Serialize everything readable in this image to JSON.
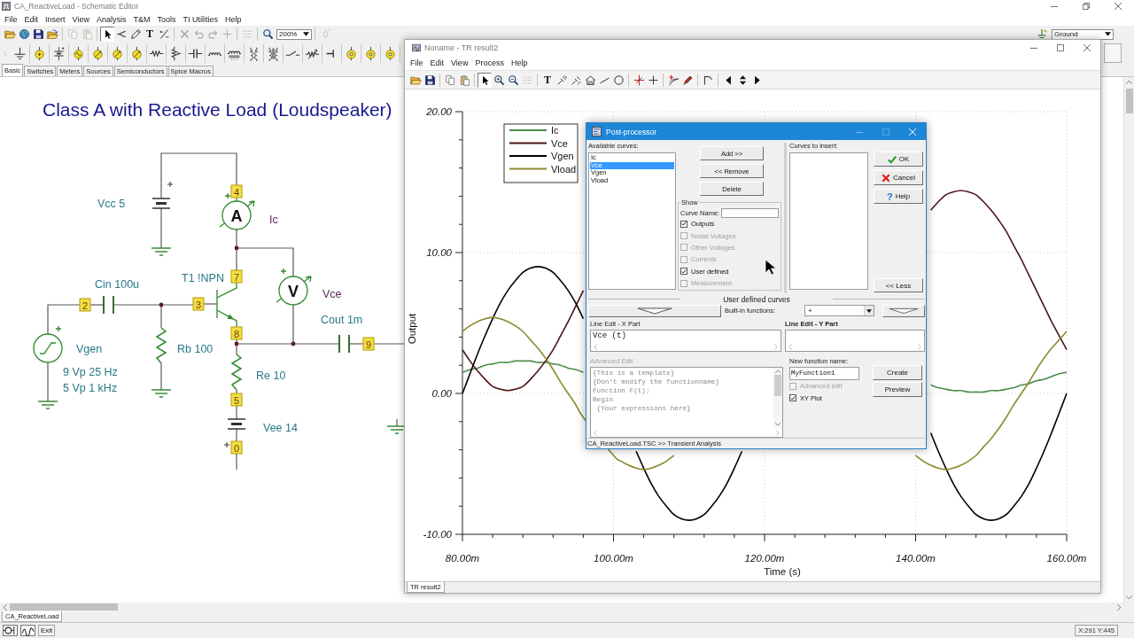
{
  "window": {
    "title": "CA_ReactiveLoad - Schematic Editor"
  },
  "menu": [
    "File",
    "Edit",
    "Insert",
    "View",
    "Analysis",
    "T&M",
    "Tools",
    "TI Utilities",
    "Help"
  ],
  "toolbar": {
    "buttons": [
      {
        "pressed": false,
        "disabled": false
      },
      {
        "pressed": false,
        "disabled": false
      },
      {
        "pressed": false,
        "disabled": false
      },
      {
        "pressed": false,
        "disabled": false
      },
      {
        "pressed": false,
        "disabled": true
      },
      {
        "pressed": false,
        "disabled": true
      },
      {
        "pressed": true,
        "disabled": false
      },
      {
        "pressed": false,
        "disabled": false
      },
      {
        "pressed": false,
        "disabled": false
      },
      {
        "glyph": "T",
        "pressed": false,
        "disabled": false
      },
      {
        "pressed": false,
        "disabled": false
      },
      {
        "pressed": false,
        "disabled": true
      },
      {
        "pressed": false,
        "disabled": true
      },
      {
        "pressed": false,
        "disabled": true
      },
      {
        "pressed": false,
        "disabled": true
      },
      {
        "pressed": false,
        "disabled": false
      },
      {
        "pressed": false,
        "disabled": false
      },
      {
        "pressed": false,
        "disabled": true
      }
    ],
    "zoom_level": "200%",
    "component": "Ground"
  },
  "component_tabs": [
    {
      "label": "Basic",
      "selected": true
    },
    {
      "label": "Switches",
      "selected": false
    },
    {
      "label": "Meters",
      "selected": false
    },
    {
      "label": "Sources",
      "selected": false
    },
    {
      "label": "Semiconductors",
      "selected": false
    },
    {
      "label": "Spice Macros",
      "selected": false
    }
  ],
  "schematic": {
    "title": "Class A with Reactive Load (Loudspeaker)",
    "components": [
      {
        "kind": "battery",
        "label": "Vcc 5"
      },
      {
        "kind": "ammeter",
        "symbol": "A",
        "label": "Ic"
      },
      {
        "kind": "voltmeter",
        "symbol": "V",
        "label": "Vce"
      },
      {
        "kind": "transistor",
        "label": "T1 !NPN"
      },
      {
        "kind": "capacitor",
        "label": "Cin 100u"
      },
      {
        "kind": "capacitor",
        "label": "Cout 1m"
      },
      {
        "kind": "generator",
        "label": "Vgen",
        "settings": [
          "9 Vp 25 Hz",
          "5 Vp 1 kHz"
        ]
      },
      {
        "kind": "resistor",
        "label": "Rb 100"
      },
      {
        "kind": "resistor",
        "label": "Re 10"
      },
      {
        "kind": "battery",
        "label": "Vee 14"
      }
    ],
    "nodes": [
      "4",
      "7",
      "2",
      "3",
      "8",
      "9",
      "5",
      "0"
    ]
  },
  "result_window": {
    "title": "Noname - TR result2",
    "menu": [
      "File",
      "Edit",
      "View",
      "Process",
      "Help"
    ],
    "toolbar": [
      {
        "pressed": false
      },
      {
        "pressed": false
      },
      {
        "pressed": false
      },
      {
        "pressed": false
      },
      {
        "pressed": true
      },
      {
        "pressed": false
      },
      {
        "pressed": false
      },
      {
        "pressed": false
      },
      {
        "glyph": "T",
        "pressed": false
      },
      {
        "pressed": false
      },
      {
        "pressed": false
      },
      {
        "pressed": false
      },
      {
        "pressed": false
      },
      {
        "pressed": false
      },
      {
        "pressed": false
      },
      {
        "pressed": false
      },
      {
        "pressed": false
      },
      {
        "pressed": false
      },
      {
        "pressed": false
      },
      {
        "pressed": false
      },
      {
        "pressed": false
      },
      {
        "pressed": false
      }
    ],
    "chart_data": {
      "type": "line",
      "xlabel": "Time (s)",
      "ylabel": "Output",
      "legend": "upper left",
      "grid": true,
      "x": [
        80,
        81,
        82,
        83,
        84,
        85,
        86,
        87,
        88,
        89,
        90,
        91,
        92,
        93,
        94,
        95,
        96,
        100,
        101,
        102,
        103,
        104,
        105,
        106,
        107,
        108,
        109,
        110,
        111,
        112,
        113,
        114,
        115,
        116,
        117,
        140,
        141,
        142,
        143,
        144,
        145,
        146,
        147,
        148,
        149,
        150,
        151,
        152,
        153,
        154,
        155,
        156,
        157,
        158,
        159,
        160
      ],
      "series": [
        {
          "name": "Ic",
          "color": "#4a8c4a",
          "values": [
            1.5,
            1.7,
            1.8,
            2.0,
            2.1,
            2.2,
            2.2,
            2.3,
            2.3,
            2.3,
            2.2,
            2.2,
            2.1,
            2.0,
            1.8,
            1.7,
            1.5,
            null,
            null,
            null,
            null,
            null,
            null,
            null,
            null,
            null,
            null,
            null,
            null,
            null,
            null,
            null,
            null,
            null,
            null,
            null,
            null,
            0.6,
            0.4,
            0.3,
            0.2,
            0.2,
            0.1,
            0.1,
            0.1,
            0.2,
            0.2,
            0.3,
            0.4,
            0.6,
            0.7,
            0.9,
            1.0,
            1.2,
            1.4,
            1.5
          ]
        },
        {
          "name": "Vce",
          "color": "#4e1414",
          "values": [
            3.1,
            2.3,
            1.6,
            1.0,
            0.5,
            0.3,
            0.2,
            0.3,
            0.5,
            1.0,
            1.6,
            2.3,
            3.1,
            4.1,
            5.1,
            6.2,
            7.3,
            null,
            null,
            null,
            null,
            null,
            null,
            null,
            null,
            null,
            null,
            null,
            null,
            null,
            null,
            null,
            null,
            null,
            null,
            null,
            null,
            13.0,
            13.6,
            14.1,
            14.3,
            14.4,
            14.3,
            14.1,
            13.6,
            13.0,
            12.3,
            11.5,
            10.5,
            9.5,
            8.4,
            7.3,
            6.2,
            5.1,
            4.1,
            3.1
          ]
        },
        {
          "name": "Vgen",
          "color": "#000000",
          "values": [
            0,
            1.4,
            2.8,
            4.1,
            5.3,
            6.4,
            7.3,
            8.0,
            8.6,
            8.9,
            9.0,
            8.9,
            8.6,
            8.0,
            7.3,
            6.4,
            5.3,
            null,
            null,
            null,
            -4.1,
            -5.3,
            -6.4,
            -7.3,
            -8.0,
            -8.6,
            -8.9,
            -9.0,
            -8.9,
            -8.6,
            -8.0,
            -7.3,
            -6.4,
            -5.3,
            -4.1,
            null,
            null,
            -2.8,
            -4.1,
            -5.3,
            -6.4,
            -7.3,
            -8.0,
            -8.6,
            -8.9,
            -9.0,
            -8.9,
            -8.6,
            -8.0,
            -7.3,
            -6.4,
            -5.3,
            -4.1,
            -2.8,
            -1.4,
            0
          ]
        },
        {
          "name": "Vload",
          "color": "#8a8a2e",
          "values": [
            4.4,
            4.8,
            5.1,
            5.3,
            5.4,
            5.3,
            5.1,
            4.8,
            4.4,
            3.8,
            3.2,
            2.5,
            1.7,
            0.8,
            0,
            -0.8,
            -1.7,
            -4.4,
            -4.8,
            -5.1,
            -5.3,
            -5.4,
            -5.3,
            -5.1,
            -4.8,
            -4.4,
            null,
            null,
            null,
            null,
            null,
            null,
            null,
            null,
            null,
            -4.4,
            -4.8,
            -5.1,
            -5.3,
            -5.4,
            -5.3,
            -5.1,
            -4.8,
            -4.4,
            -3.8,
            -3.2,
            -2.5,
            -1.7,
            -0.8,
            0,
            0.8,
            1.7,
            2.5,
            3.2,
            3.8,
            4.4
          ]
        }
      ],
      "xlim": [
        80,
        160
      ],
      "ylim": [
        -10,
        20
      ],
      "xticks": [
        {
          "value": 80,
          "label": "80.00m"
        },
        {
          "value": 100,
          "label": "100.00m"
        },
        {
          "value": 120,
          "label": "120.00m"
        },
        {
          "value": 140,
          "label": "140.00m"
        },
        {
          "value": 160,
          "label": "160.00m"
        }
      ],
      "yticks": [
        {
          "value": -10,
          "label": "-10.00"
        },
        {
          "value": 0,
          "label": "0.00"
        },
        {
          "value": 10,
          "label": "10.00"
        },
        {
          "value": 20,
          "label": "20.00"
        }
      ]
    },
    "tab": "TR result2"
  },
  "post_processor": {
    "title": "Post-processor",
    "available_label": "Available curves:",
    "available": [
      {
        "label": "Ic",
        "selected": false
      },
      {
        "label": "Vce",
        "selected": true
      },
      {
        "label": "Vgen",
        "selected": false
      },
      {
        "label": "Vload",
        "selected": false
      }
    ],
    "buttons": [
      "Add >>",
      "<< Remove",
      "Delete"
    ],
    "show": {
      "title": "Show",
      "curve_name_label": "Curve Name:",
      "options": [
        {
          "label": "Outputs",
          "checked": true,
          "disabled": false
        },
        {
          "label": "Nodal Voltages",
          "checked": false,
          "disabled": true
        },
        {
          "label": "Other Voltages",
          "checked": false,
          "disabled": true
        },
        {
          "label": "Currents",
          "checked": false,
          "disabled": true
        },
        {
          "label": "User defined",
          "checked": true,
          "disabled": false
        },
        {
          "label": "Measurement",
          "checked": false,
          "disabled": true
        }
      ]
    },
    "insert_label": "Curves to insert:",
    "actions": [
      {
        "label": "OK",
        "kind": "ok"
      },
      {
        "label": "Cancel",
        "kind": "cancel"
      },
      {
        "label": "Help",
        "kind": "help",
        "glyph": "?"
      }
    ],
    "less_button": "<< Less",
    "section_title": "User defined curves",
    "builtin_label": "Built-in functions:",
    "builtin_value": "+",
    "x_part": {
      "label": "Line Edit - X Part",
      "value": "Vce (t)",
      "active": false
    },
    "y_part": {
      "label": "Line Edit - Y Part",
      "active": true
    },
    "advanced": {
      "label": "Advanced Edit",
      "disabled": true,
      "lines": [
        "{This is a template}",
        "{Don't modify the functionname}",
        "Function F(t);",
        "Begin",
        " {Your expressions here}"
      ]
    },
    "function_name": {
      "label": "New function name:",
      "value": "MyFunction1"
    },
    "options": [
      {
        "label": "Advanced edit",
        "checked": false,
        "disabled": true
      },
      {
        "label": "XY Plot",
        "checked": true,
        "disabled": false
      }
    ],
    "side_buttons": [
      "Create",
      "Preview"
    ],
    "status": "CA_ReactiveLoad.TSC >> Transient Analysis"
  },
  "document_tab": "CA_ReactiveLoad",
  "status_bar": {
    "exit": "Exit",
    "position": "X:291 Y:445"
  }
}
